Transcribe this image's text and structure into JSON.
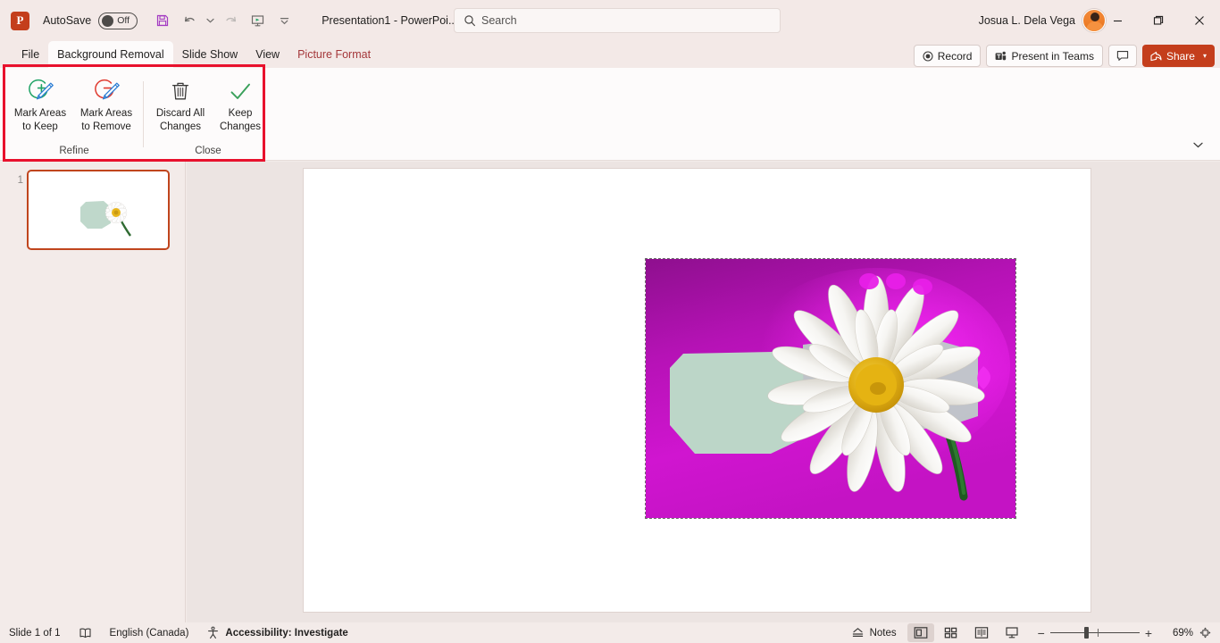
{
  "titlebar": {
    "app_logo": "powerpoint-logo",
    "autosave_label": "AutoSave",
    "autosave_state": "Off",
    "document_title": "Presentation1  -  PowerPoi...",
    "quick_access": [
      {
        "name": "save-button",
        "icon": "save-icon"
      },
      {
        "name": "undo-button",
        "icon": "undo-icon"
      },
      {
        "name": "undo-dropdown",
        "icon": "chevron-down-icon"
      },
      {
        "name": "redo-button",
        "icon": "redo-icon"
      },
      {
        "name": "start-slideshow-button",
        "icon": "slideshow-icon"
      },
      {
        "name": "customize-quick-access-button",
        "icon": "chevron-down-bar-icon"
      }
    ],
    "user_name": "Josua L. Dela Vega",
    "window_controls": {
      "minimize": "—",
      "maximize": "❐",
      "close": "✕"
    }
  },
  "search": {
    "placeholder": "Search",
    "value": "",
    "icon": "search-icon"
  },
  "tabs": [
    {
      "label": "File",
      "active": false,
      "contextual": false
    },
    {
      "label": "Background Removal",
      "active": true,
      "contextual": false
    },
    {
      "label": "Slide Show",
      "active": false,
      "contextual": false
    },
    {
      "label": "View",
      "active": false,
      "contextual": false
    },
    {
      "label": "Picture Format",
      "active": false,
      "contextual": true
    }
  ],
  "tab_right_buttons": [
    {
      "label": "Record",
      "icon": "record-icon"
    },
    {
      "label": "Present in Teams",
      "icon": "teams-icon"
    },
    {
      "label": "",
      "icon": "comment-icon"
    }
  ],
  "share": {
    "label": "Share",
    "icon": "share-icon",
    "caret": "▾",
    "color": "#c43e1c"
  },
  "ribbon": {
    "collapse_icon": "chevron-down-icon",
    "groups": [
      {
        "name": "refine",
        "label": "Refine",
        "items": [
          {
            "name": "mark-areas-to-keep",
            "line1": "Mark Areas",
            "line2": "to Keep",
            "icon": "mark-keep-icon",
            "color": "#21a366"
          },
          {
            "name": "mark-areas-to-remove",
            "line1": "Mark Areas",
            "line2": "to Remove",
            "icon": "mark-remove-icon",
            "color": "#e03c31"
          }
        ]
      },
      {
        "name": "close",
        "label": "Close",
        "items": [
          {
            "name": "discard-all-changes",
            "line1": "Discard All",
            "line2": "Changes",
            "icon": "trash-icon",
            "color": "#3b3a39"
          },
          {
            "name": "keep-changes",
            "line1": "Keep",
            "line2": "Changes",
            "icon": "check-icon",
            "color": "#21a366"
          }
        ]
      }
    ]
  },
  "annotation": {
    "name": "red-highlight-box",
    "color": "#e8112d"
  },
  "slides_panel": {
    "slides": [
      {
        "number": "1",
        "selected": true,
        "name": "slide-thumbnail-1"
      }
    ]
  },
  "slide": {
    "picture": {
      "name": "daisy-picture",
      "alt": "White daisy flower on magenta background-removal overlay",
      "removal_color": "#c800c8",
      "keep_color": "#ffffff",
      "marked_region_color": "#bcd6c8"
    }
  },
  "statusbar": {
    "slide_count": "Slide 1 of 1",
    "notes_icon": "notes-icon",
    "language": "English (Canada)",
    "accessibility": "Accessibility: Investigate",
    "accessibility_icon": "accessibility-icon",
    "notes_label": "Notes",
    "view_buttons": [
      {
        "name": "view-normal",
        "icon": "normal-view-icon",
        "active": true
      },
      {
        "name": "view-slide-sorter",
        "icon": "slide-sorter-icon",
        "active": false
      },
      {
        "name": "view-reading",
        "icon": "reading-view-icon",
        "active": false
      },
      {
        "name": "view-slideshow",
        "icon": "slideshow-view-icon",
        "active": false
      }
    ],
    "zoom_out": "−",
    "zoom_in": "+",
    "zoom_level": "69%",
    "fit_icon": "fit-slide-icon"
  }
}
